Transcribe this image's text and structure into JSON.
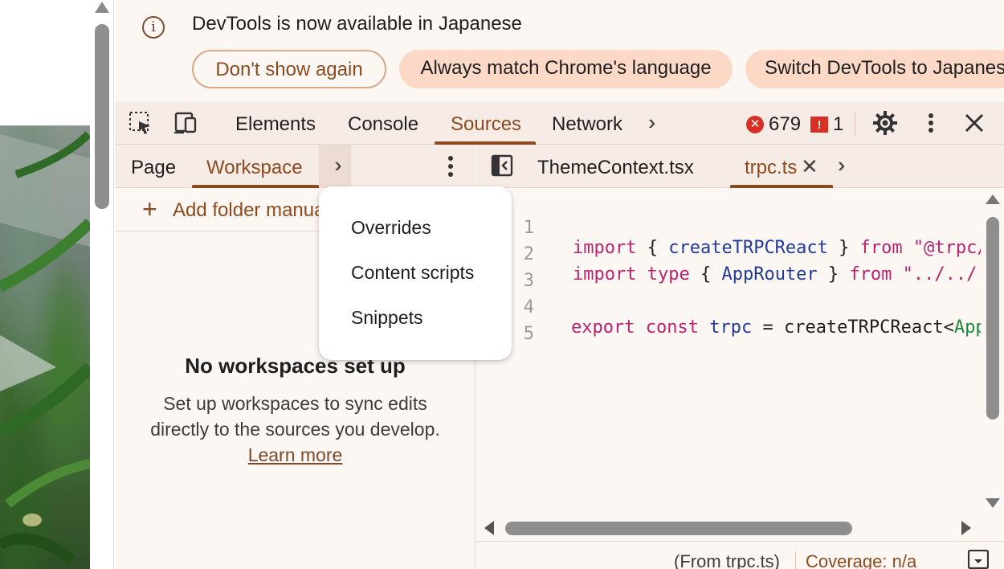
{
  "infobar": {
    "message": "DevTools is now available in Japanese",
    "dont_show_again": "Don't show again",
    "always_match": "Always match Chrome's language",
    "switch_language": "Switch DevTools to Japanese"
  },
  "toolbar": {
    "tabs": [
      "Elements",
      "Console",
      "Sources",
      "Network"
    ],
    "error_count": "679",
    "issue_count": "1",
    "error_symbol": "✕",
    "issue_symbol": "!"
  },
  "navigator": {
    "tabs": [
      "Page",
      "Workspace"
    ],
    "add_folder": "Add folder manually",
    "empty_title": "No workspaces set up",
    "empty_desc": "Set up workspaces to sync edits directly to the sources you develop.",
    "learn_more": "Learn more"
  },
  "menu": {
    "items": [
      "Overrides",
      "Content scripts",
      "Snippets"
    ]
  },
  "editor": {
    "tabs": [
      "ThemeContext.tsx",
      "trpc.ts"
    ],
    "close_glyph": "✕",
    "line_numbers": [
      "1",
      "2",
      "3",
      "4",
      "5"
    ],
    "code": [
      "import { createTRPCReact } from \"@trpc/react-query\";",
      "import type { AppRouter } from \"../../../server/api/root\";",
      "",
      "export const trpc = createTRPCReact<AppRouter>();",
      ""
    ],
    "code_tokens": {
      "l1": [
        "import",
        " { ",
        "createTRPCReact",
        " } ",
        "from",
        " \"@trpc/react-query\";"
      ],
      "l2": [
        "import",
        " ",
        "type",
        " { ",
        "AppRouter",
        " } ",
        "from",
        " \"../../../server/api/root\";"
      ],
      "l4": [
        "export",
        " ",
        "const",
        " ",
        "trpc",
        " = ",
        "createTRPCReact",
        "<",
        "AppRouter",
        ">();"
      ]
    },
    "status_from": "(From trpc.ts)",
    "status_coverage": "Coverage: n/a"
  },
  "colors": {
    "accent": "#8b4a1f",
    "chip_bg": "#fcd9c6",
    "panel_bg": "#fdf7f4",
    "toolbar_bg": "#f7ebe5",
    "error": "#d93025",
    "keyword": "#b8246d",
    "identifier": "#1f3a99",
    "type": "#1a8a3a"
  },
  "icons": [
    "info-icon",
    "inspect-element-icon",
    "device-toolbar-icon",
    "more-tabs-icon",
    "error-icon",
    "issue-icon",
    "settings-gear-icon",
    "more-vertical-icon",
    "close-icon",
    "plus-icon",
    "toggle-navigator-icon",
    "drawer-icon"
  ]
}
